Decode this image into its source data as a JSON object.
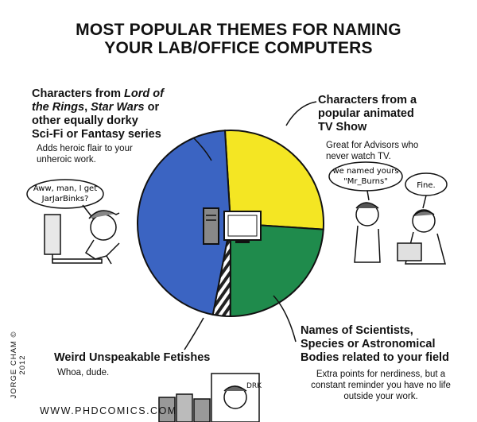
{
  "chart_data": {
    "type": "pie",
    "title": [
      "MOST POPULAR THEMES FOR NAMING",
      "YOUR LAB/OFFICE COMPUTERS"
    ],
    "slices": [
      {
        "label_parts": [
          {
            "text": "Characters from a",
            "italic": false
          },
          {
            "text": "popular animated",
            "italic": false
          },
          {
            "text": "TV Show",
            "italic": false
          }
        ],
        "annotation": "Great for Advisors who never watch TV.",
        "value": 27,
        "color": "#f4e623"
      },
      {
        "label_parts": [
          {
            "text": "Names of Scientists,",
            "italic": false
          },
          {
            "text": "Species or Astronomical",
            "italic": false
          },
          {
            "text": "Bodies related to your field",
            "italic": false
          }
        ],
        "annotation": "Extra points for nerdiness, but a constant reminder you have no life outside your work.",
        "value": 24,
        "color": "#1f8b4c"
      },
      {
        "label_parts": [
          {
            "text": "Weird Unspeakable Fetishes",
            "italic": false
          }
        ],
        "annotation": "Whoa, dude.",
        "value": 3,
        "color": "#222222",
        "pattern": "stripes"
      },
      {
        "label_parts": [
          {
            "text": "Characters from ",
            "italic": false
          },
          {
            "text": "Lord of",
            "italic": true
          },
          {
            "text": "the Rings",
            "italic": true
          },
          {
            "text": ", ",
            "italic": false
          },
          {
            "text": "Star Wars",
            "italic": true
          },
          {
            "text": " or",
            "italic": false
          },
          {
            "text": "other equally dorky",
            "italic": false
          },
          {
            "text": "Sci-Fi or Fantasy series",
            "italic": false
          }
        ],
        "annotation": "Adds heroic flair to your unheroic work.",
        "value": 46,
        "color": "#3b64c2"
      }
    ]
  },
  "speech": {
    "left": "Aww, man, I get JarJarBinks?",
    "right_1": "we named yours \"Mr_Burns\"",
    "right_2": "Fine.",
    "sign": "DRK"
  },
  "credits": {
    "vertical": "JORGE CHAM © 2012",
    "url": "WWW.PHDCOMICS.COM"
  }
}
